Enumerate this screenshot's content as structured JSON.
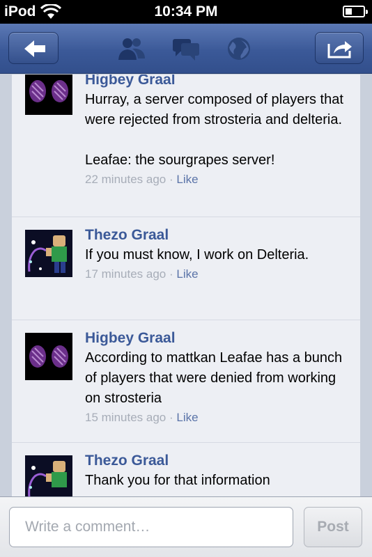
{
  "status": {
    "carrier": "iPod",
    "time": "10:34 PM"
  },
  "nav": {
    "icons": [
      "back-arrow-icon",
      "friends-icon",
      "messages-icon",
      "globe-icon",
      "share-icon"
    ],
    "bar_color": "#3b5998"
  },
  "comments": [
    {
      "name": "Higbey Graal",
      "text": "Hurray, a server composed of players that were rejected from strosteria and delteria.\n\nLeafae: the sourgrapes server!",
      "time": "22 minutes ago",
      "like": "Like"
    },
    {
      "name": "Thezo Graal",
      "text": "If you must know, I work on Delteria.",
      "time": "17 minutes ago",
      "like": "Like"
    },
    {
      "name": "Higbey Graal",
      "text": "According to mattkan Leafae has a bunch of players that were denied from working on strosteria",
      "time": "15 minutes ago",
      "like": "Like"
    },
    {
      "name": "Thezo Graal",
      "text": "Thank you for that information",
      "time": "",
      "like": ""
    }
  ],
  "meta_separator": " · ",
  "composer": {
    "placeholder": "Write a comment…",
    "post_label": "Post"
  }
}
